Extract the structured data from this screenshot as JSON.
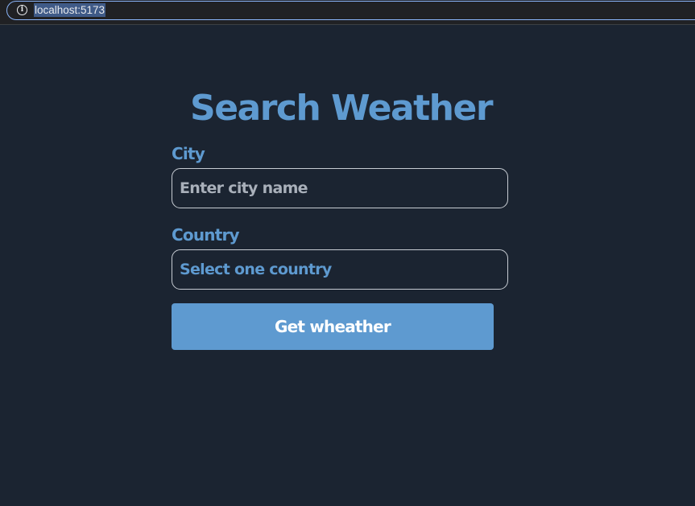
{
  "browser": {
    "url": "localhost:5173",
    "info_icon": "info-icon"
  },
  "page": {
    "title": "Search Weather",
    "city": {
      "label": "City",
      "placeholder": "Enter city name",
      "value": ""
    },
    "country": {
      "label": "Country",
      "selected": "Select one country"
    },
    "submit_label": "Get wheather"
  },
  "colors": {
    "background": "#1b2431",
    "accent": "#5e9ad0",
    "field_border": "#c7ccd3",
    "placeholder": "#a9b0ba",
    "button_text": "#ffffff"
  }
}
